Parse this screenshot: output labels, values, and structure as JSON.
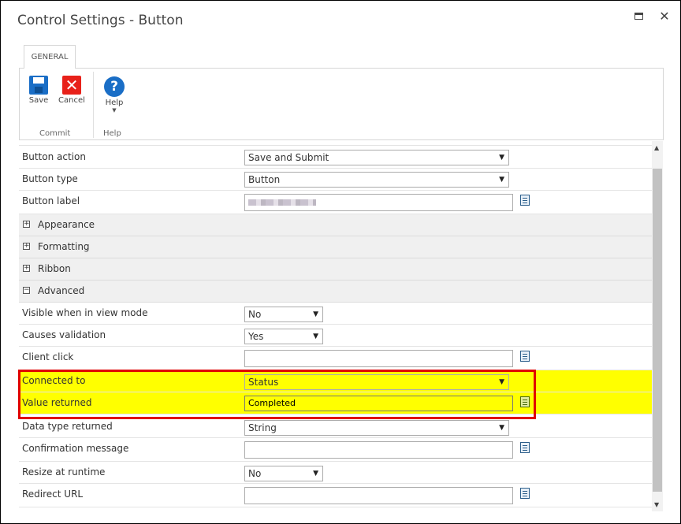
{
  "window": {
    "title": "Control Settings - Button"
  },
  "tab": {
    "label": "GENERAL"
  },
  "ribbon": {
    "save_label": "Save",
    "cancel_label": "Cancel",
    "help_label": "Help",
    "help_icon": "?",
    "group_commit": "Commit",
    "group_help": "Help"
  },
  "fields": {
    "button_action": {
      "label": "Button action",
      "value": "Save and Submit"
    },
    "button_type": {
      "label": "Button type",
      "value": "Button"
    },
    "button_label": {
      "label": "Button label",
      "value": ""
    },
    "sections": {
      "appearance": "Appearance",
      "formatting": "Formatting",
      "ribbon": "Ribbon",
      "advanced": "Advanced"
    },
    "visible_view_mode": {
      "label": "Visible when in view mode",
      "value": "No"
    },
    "causes_validation": {
      "label": "Causes validation",
      "value": "Yes"
    },
    "client_click": {
      "label": "Client click",
      "value": ""
    },
    "connected_to": {
      "label": "Connected to",
      "value": "Status"
    },
    "value_returned": {
      "label": "Value returned",
      "value": "Completed"
    },
    "data_type_returned": {
      "label": "Data type returned",
      "value": "String"
    },
    "confirmation_message": {
      "label": "Confirmation message",
      "value": ""
    },
    "resize_at_runtime": {
      "label": "Resize at runtime",
      "value": "No"
    },
    "redirect_url": {
      "label": "Redirect URL",
      "value": ""
    }
  },
  "colors": {
    "highlight": "#ffff00",
    "highlight_border": "#e00000",
    "accent": "#1a6ec6"
  }
}
